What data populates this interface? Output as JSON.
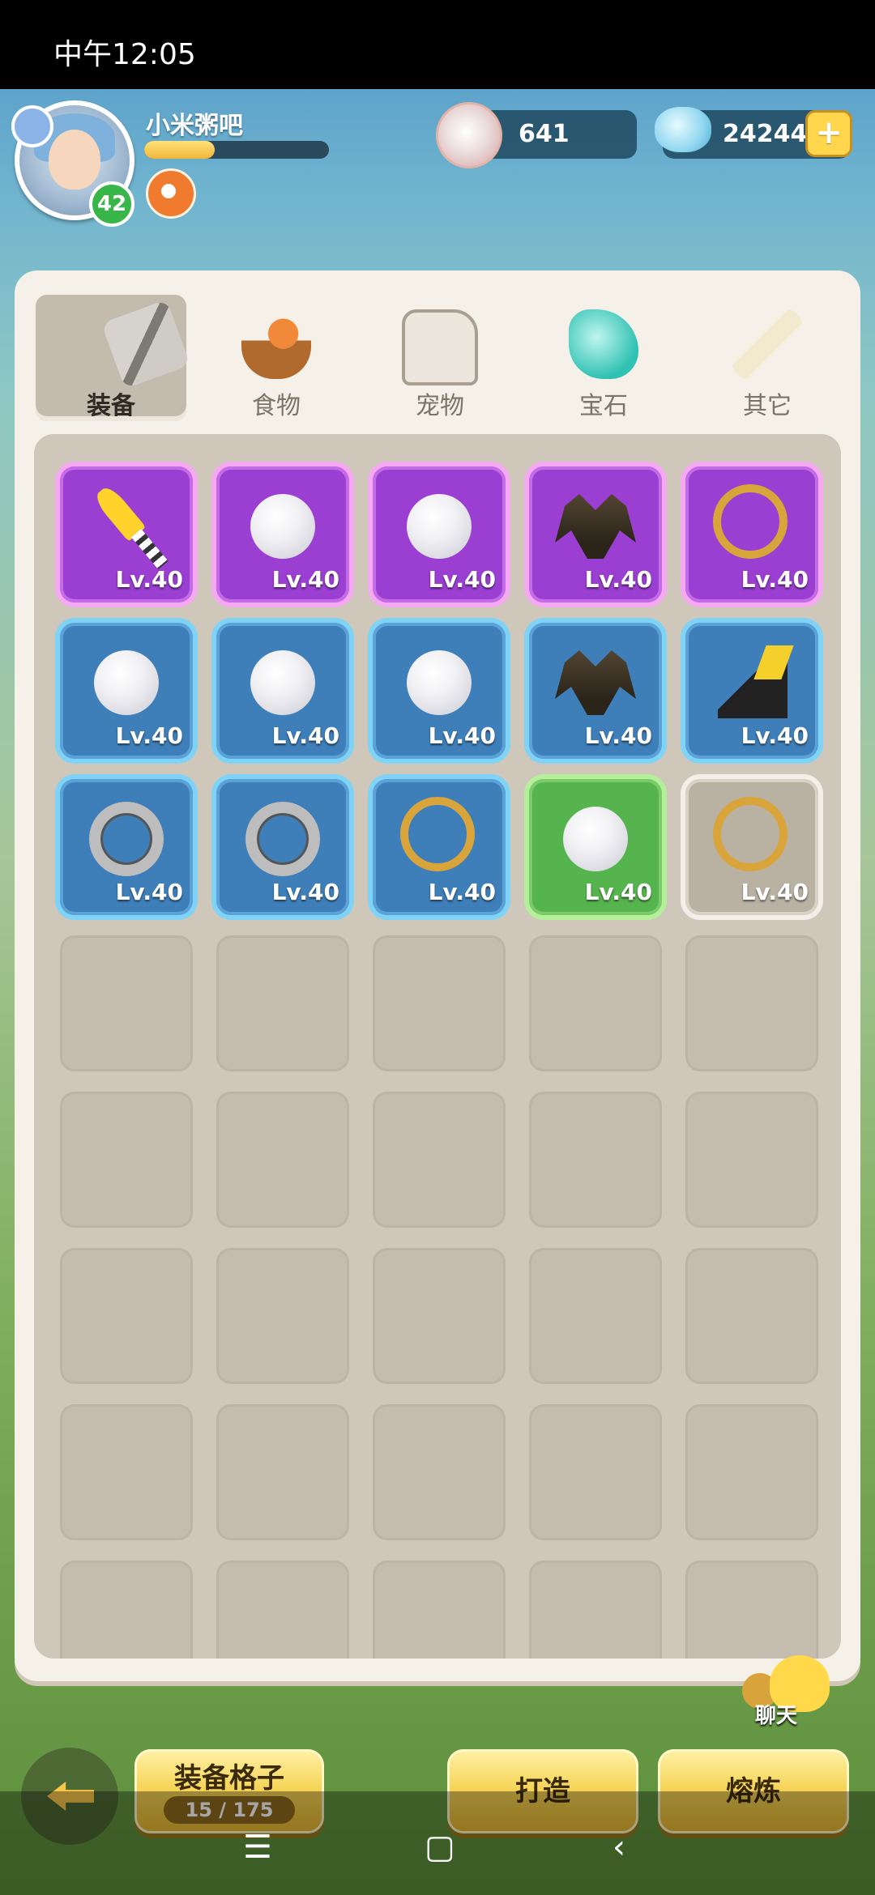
{
  "status_bar": {
    "time": "中午12:05"
  },
  "player": {
    "name": "小米粥吧",
    "level": "42",
    "exp_fraction": 0.38
  },
  "currencies": {
    "pearl": "641",
    "diamond": "24244"
  },
  "tabs": [
    {
      "label": "装备",
      "icon": "stone-hammer-icon",
      "active": true
    },
    {
      "label": "食物",
      "icon": "food-basket-icon",
      "active": false
    },
    {
      "label": "宠物",
      "icon": "pet-skull-icon",
      "active": false
    },
    {
      "label": "宝石",
      "icon": "gem-icon",
      "active": false
    },
    {
      "label": "其它",
      "icon": "bone-icon",
      "active": false
    }
  ],
  "items": [
    {
      "rarity": "purple",
      "icon": "sword-icon",
      "level": "Lv.40"
    },
    {
      "rarity": "purple",
      "icon": "pearl-icon",
      "level": "Lv.40"
    },
    {
      "rarity": "purple",
      "icon": "pearl-icon",
      "level": "Lv.40"
    },
    {
      "rarity": "purple",
      "icon": "shoulder-armor-icon",
      "level": "Lv.40"
    },
    {
      "rarity": "purple",
      "icon": "necklace-icon",
      "level": "Lv.40"
    },
    {
      "rarity": "blue",
      "icon": "pearl-icon",
      "level": "Lv.40"
    },
    {
      "rarity": "blue",
      "icon": "pearl-icon",
      "level": "Lv.40"
    },
    {
      "rarity": "blue",
      "icon": "pearl-icon",
      "level": "Lv.40"
    },
    {
      "rarity": "blue",
      "icon": "shoulder-armor-icon",
      "level": "Lv.40"
    },
    {
      "rarity": "blue",
      "icon": "boot-icon",
      "level": "Lv.40"
    },
    {
      "rarity": "blue",
      "icon": "ring-icon",
      "level": "Lv.40"
    },
    {
      "rarity": "blue",
      "icon": "ring-icon",
      "level": "Lv.40"
    },
    {
      "rarity": "blue",
      "icon": "necklace-icon",
      "level": "Lv.40"
    },
    {
      "rarity": "green",
      "icon": "pearl-icon",
      "level": "Lv.40"
    },
    {
      "rarity": "white",
      "icon": "necklace-icon",
      "level": "Lv.40"
    }
  ],
  "empty_slot_rows_visible": 5,
  "chat": {
    "label": "聊天"
  },
  "bottom": {
    "slots_label": "装备格子",
    "slots_count": "15 / 175",
    "forge_label": "打造",
    "smelt_label": "熔炼"
  },
  "colors": {
    "purple": "#9a3fd1",
    "blue": "#3f7fb9",
    "green": "#56b44e",
    "white": "#b9b2a3",
    "button_yellow": "#f6d55a"
  }
}
